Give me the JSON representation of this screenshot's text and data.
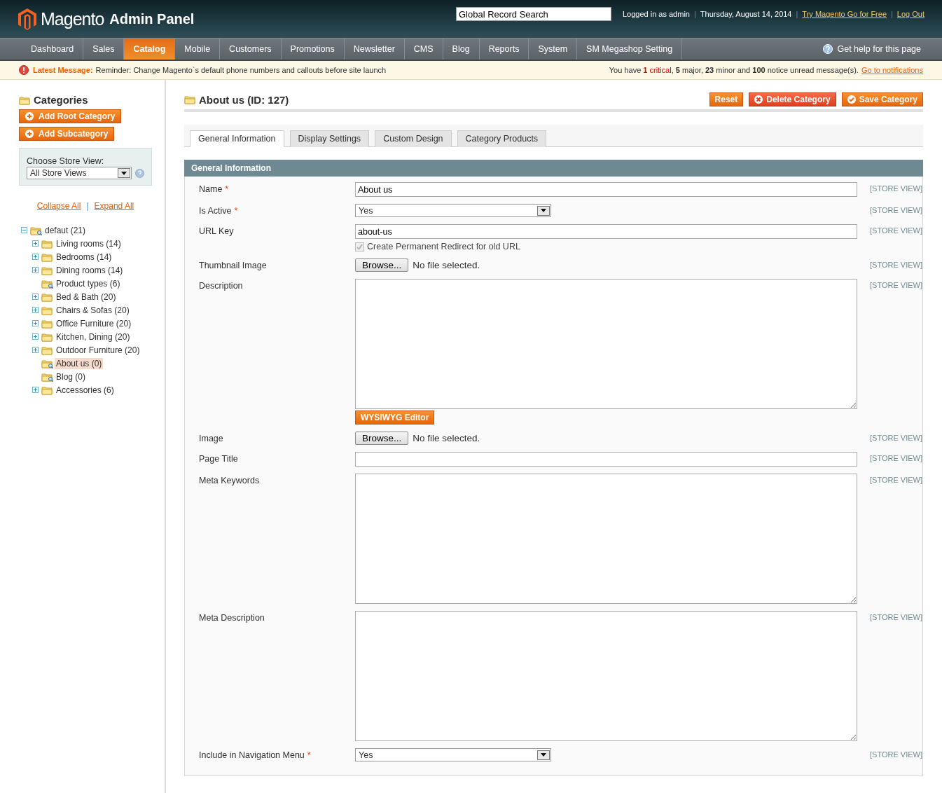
{
  "header": {
    "brand": "Magento",
    "brand_suffix": "Admin Panel",
    "search": {
      "value": "Global Record Search"
    },
    "links": [
      {
        "kind": "text",
        "label": "Logged in as admin"
      },
      {
        "kind": "separator",
        "label": "|"
      },
      {
        "kind": "text",
        "label": "Thursday, August 14, 2014"
      },
      {
        "kind": "separator",
        "label": "|"
      },
      {
        "kind": "link",
        "label": "Try Magento Go for Free"
      },
      {
        "kind": "separator",
        "label": "|"
      },
      {
        "kind": "link",
        "label": "Log Out"
      }
    ]
  },
  "nav": {
    "items": [
      {
        "label": "Dashboard",
        "selected": false
      },
      {
        "label": "Sales",
        "selected": false
      },
      {
        "label": "Catalog",
        "selected": true
      },
      {
        "label": "Mobile",
        "selected": false
      },
      {
        "label": "Customers",
        "selected": false
      },
      {
        "label": "Promotions",
        "selected": false
      },
      {
        "label": "Newsletter",
        "selected": false
      },
      {
        "label": "CMS",
        "selected": false
      },
      {
        "label": "Blog",
        "selected": false
      },
      {
        "label": "Reports",
        "selected": false
      },
      {
        "label": "System",
        "selected": false
      },
      {
        "label": "SM Megashop Setting",
        "selected": false
      }
    ],
    "help": "Get help for this page"
  },
  "message_bar": {
    "label": "Latest Message:",
    "text": "Reminder: Change Magento`s default phone numbers and callouts before site launch",
    "summary_prefix": "You have ",
    "summary_critical": "**1** critical",
    "summary_rest": ", **5** major, **23** minor and **100** notice unread message(s).",
    "link": "Go to notifications"
  },
  "sidebar": {
    "title": "Categories",
    "buttons": [
      "Add Root Category",
      "Add Subcategory"
    ],
    "store_view": {
      "label": "Choose Store View:",
      "value": "All Store Views"
    },
    "tree_links": [
      {
        "kind": "link",
        "label": "Collapse All"
      },
      {
        "kind": "separator",
        "label": "|"
      },
      {
        "kind": "link",
        "label": "Expand All"
      }
    ],
    "tree": [
      {
        "label": "defaut (21)",
        "kind": "anchor",
        "expandable": true,
        "expanded": true,
        "selected": false,
        "children": [
          {
            "label": "Living rooms (14)",
            "kind": "folder",
            "expandable": true,
            "expanded": false,
            "selected": false
          },
          {
            "label": "Bedrooms (14)",
            "kind": "folder",
            "expandable": true,
            "expanded": false,
            "selected": false
          },
          {
            "label": "Dining rooms (14)",
            "kind": "folder",
            "expandable": true,
            "expanded": false,
            "selected": false
          },
          {
            "label": "Product types (6)",
            "kind": "anchor",
            "expandable": false,
            "selected": false
          },
          {
            "label": "Bed & Bath (20)",
            "kind": "folder",
            "expandable": true,
            "expanded": false,
            "selected": false
          },
          {
            "label": "Chairs & Sofas (20)",
            "kind": "folder",
            "expandable": true,
            "expanded": false,
            "selected": false
          },
          {
            "label": "Office Furniture (20)",
            "kind": "folder",
            "expandable": true,
            "expanded": false,
            "selected": false
          },
          {
            "label": "Kitchen, Dining (20)",
            "kind": "folder",
            "expandable": true,
            "expanded": false,
            "selected": false
          },
          {
            "label": "Outdoor Furniture (20)",
            "kind": "folder",
            "expandable": true,
            "expanded": false,
            "selected": false
          },
          {
            "label": "About us (0)",
            "kind": "anchor",
            "expandable": false,
            "selected": true
          },
          {
            "label": "Blog (0)",
            "kind": "anchor",
            "expandable": false,
            "selected": false
          },
          {
            "label": "Accessories (6)",
            "kind": "folder",
            "expandable": true,
            "expanded": false,
            "selected": false
          }
        ]
      }
    ]
  },
  "main": {
    "title": "About us (ID: 127)",
    "actions": [
      {
        "kind": "plain",
        "label": "Reset"
      },
      {
        "kind": "delete",
        "label": "Delete Category"
      },
      {
        "kind": "save",
        "label": "Save Category"
      }
    ],
    "tabs": [
      {
        "label": "General Information",
        "selected": true
      },
      {
        "label": "Display Settings",
        "selected": false
      },
      {
        "label": "Custom Design",
        "selected": false
      },
      {
        "label": "Category Products",
        "selected": false
      }
    ],
    "section_title": "General Information",
    "fields": [
      {
        "kind": "text",
        "label": "Name",
        "required_mark": "*",
        "value": "About us",
        "scope": "[STORE VIEW]"
      },
      {
        "kind": "select",
        "label": "Is Active",
        "required_mark": "*",
        "value": "Yes",
        "scope": "[STORE VIEW]"
      },
      {
        "kind": "text",
        "label": "URL Key",
        "value": "about-us",
        "scope": "[STORE VIEW]",
        "checkbox": {
          "label": "Create Permanent Redirect for old URL",
          "checked": true,
          "disabled": true
        }
      },
      {
        "kind": "file",
        "label": "Thumbnail Image",
        "button": "Browse...",
        "status": "No file selected.",
        "scope": "[STORE VIEW]"
      },
      {
        "kind": "textarea",
        "label": "Description",
        "scope": "[STORE VIEW]",
        "editor_button": "WYSIWYG Editor"
      },
      {
        "kind": "file",
        "label": "Image",
        "button": "Browse...",
        "status": "No file selected.",
        "scope": "[STORE VIEW]"
      },
      {
        "kind": "text",
        "label": "Page Title",
        "scope": "[STORE VIEW]"
      },
      {
        "kind": "textarea",
        "label": "Meta Keywords",
        "scope": "[STORE VIEW]"
      },
      {
        "kind": "textarea",
        "label": "Meta Description",
        "scope": "[STORE VIEW]"
      },
      {
        "kind": "select",
        "label": "Include in Navigation Menu",
        "required_mark": "*",
        "value": "Yes",
        "scope": "[STORE VIEW]"
      }
    ]
  }
}
